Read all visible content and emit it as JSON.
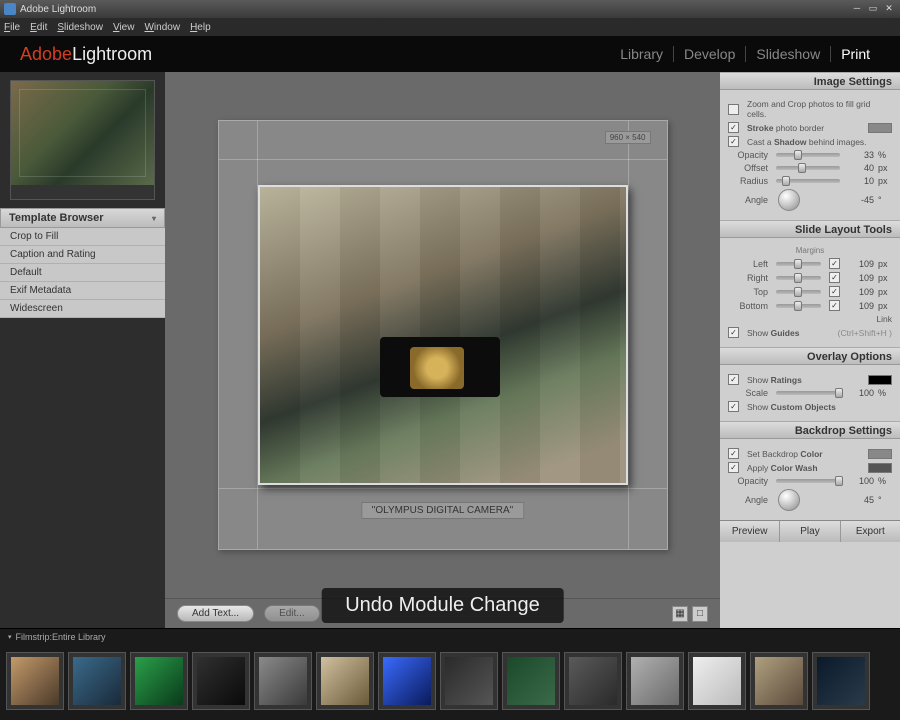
{
  "titlebar": {
    "title": "Adobe Lightroom"
  },
  "menubar": {
    "items": [
      "File",
      "Edit",
      "Slideshow",
      "View",
      "Window",
      "Help"
    ]
  },
  "logo": {
    "brand": "Adobe",
    "product": "Lightroom"
  },
  "modules": {
    "items": [
      "Library",
      "Develop",
      "Slideshow",
      "Print"
    ],
    "active": "Print"
  },
  "left": {
    "thumb_caption": "",
    "template_header": "Template Browser",
    "templates": [
      "Crop to Fill",
      "Caption and Rating",
      "Default",
      "Exif Metadata",
      "Widescreen"
    ]
  },
  "canvas": {
    "dim_badge": "960 × 540",
    "caption": "\"OLYMPUS DIGITAL CAMERA\""
  },
  "bottom_toolbar": {
    "add_text": "Add Text...",
    "edit": "Edit..."
  },
  "toast": "Undo Module Change",
  "right": {
    "image_settings": {
      "header": "Image Settings",
      "zoom_crop": "Zoom and Crop photos to fill grid cells.",
      "stroke": "Stroke photo border",
      "shadow": "Cast a Shadow behind images.",
      "opacity_label": "Opacity",
      "opacity_val": "33",
      "opacity_unit": "%",
      "offset_label": "Offset",
      "offset_val": "40",
      "offset_unit": "px",
      "radius_label": "Radius",
      "radius_val": "10",
      "radius_unit": "px",
      "angle_label": "Angle",
      "angle_val": "-45",
      "angle_unit": "°"
    },
    "layout": {
      "header": "Slide Layout Tools",
      "margins": "Margins",
      "left_label": "Left",
      "left_val": "109",
      "left_unit": "px",
      "right_label": "Right",
      "right_val": "109",
      "right_unit": "px",
      "top_label": "Top",
      "top_val": "109",
      "top_unit": "px",
      "bottom_label": "Bottom",
      "bottom_val": "109",
      "bottom_unit": "px",
      "link": "Link",
      "show_guides": "Show Guides",
      "guides_hint": "(Ctrl+Shift+H )"
    },
    "overlay": {
      "header": "Overlay Options",
      "ratings": "Show Ratings",
      "scale_label": "Scale",
      "scale_val": "100",
      "scale_unit": "%",
      "custom": "Show Custom Objects"
    },
    "backdrop": {
      "header": "Backdrop Settings",
      "set_color": "Set Backdrop Color",
      "color_wash": "Apply Color Wash",
      "opacity_label": "Opacity",
      "opacity_val": "100",
      "opacity_unit": "%",
      "angle_label": "Angle",
      "angle_val": "45",
      "angle_unit": "°"
    },
    "buttons": {
      "preview": "Preview",
      "play": "Play",
      "export": "Export"
    }
  },
  "filmstrip": {
    "label_prefix": "Filmstrip:  ",
    "label": "Entire Library",
    "count": 14
  }
}
